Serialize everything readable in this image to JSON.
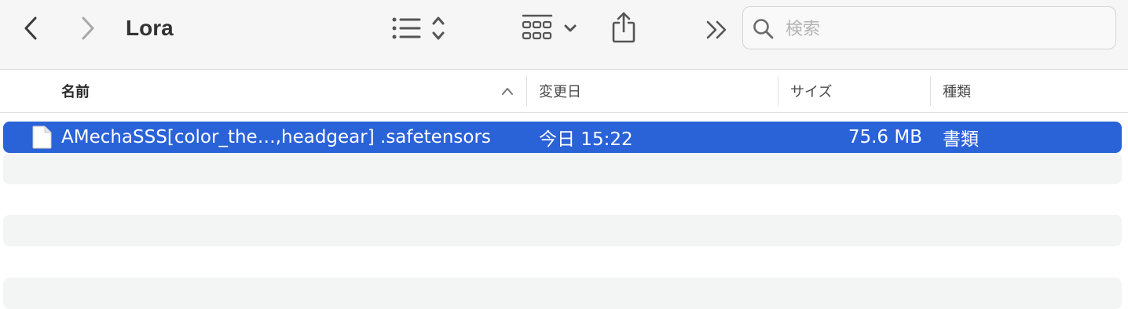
{
  "window": {
    "title": "Lora"
  },
  "toolbar": {
    "back_icon": "chevron-left-icon",
    "forward_icon": "chevron-right-icon",
    "list_view_icon": "list-view-icon",
    "group_icon": "icon-grid-group-icon",
    "share_icon": "share-icon",
    "more_icon": "double-chevron-right-icon"
  },
  "search": {
    "placeholder": "検索",
    "value": ""
  },
  "columns": {
    "name": "名前",
    "date": "変更日",
    "size": "サイズ",
    "kind": "種類",
    "sort": "ascending"
  },
  "files": [
    {
      "name": "AMechaSSS[color_the…,headgear] .safetensors",
      "date": "今日 15:22",
      "size": "75.6 MB",
      "kind": "書類",
      "selected": true
    }
  ],
  "colors": {
    "selection": "#2a62d8",
    "toolbar_bg": "#f6f6f6",
    "stripe": "#f3f4f4"
  }
}
